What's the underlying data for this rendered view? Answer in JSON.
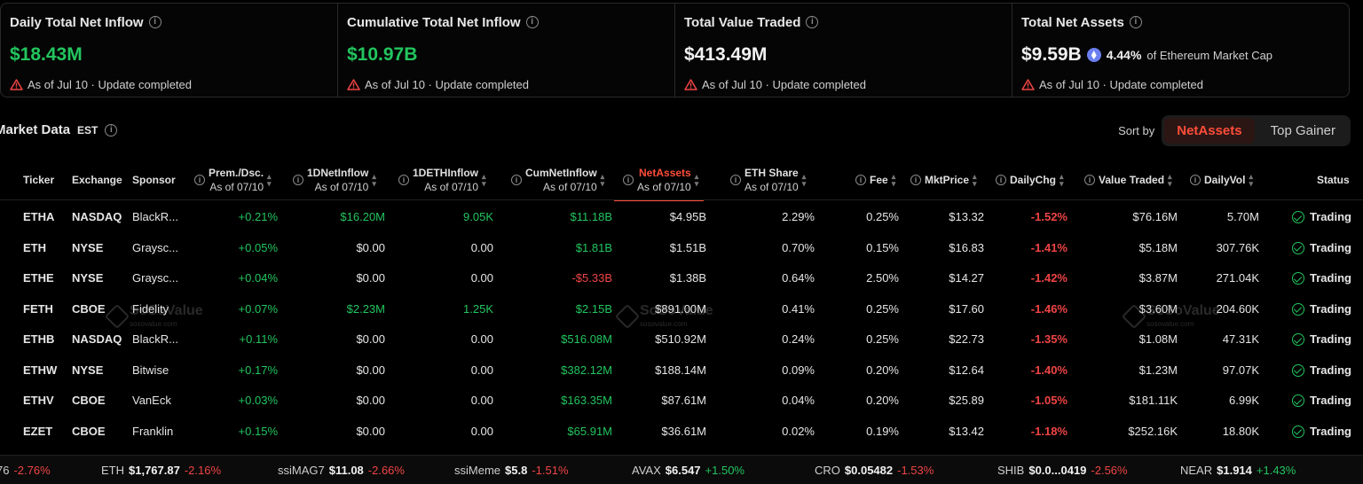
{
  "stats": [
    {
      "title": "Daily Total Net Inflow",
      "value": "$18.43M",
      "foot": "As of Jul 10 · Update completed"
    },
    {
      "title": "Cumulative Total Net Inflow",
      "value": "$10.97B",
      "foot": "As of Jul 10 · Update completed"
    },
    {
      "title": "Total Value Traded",
      "value": "$413.49M",
      "foot": "As of Jul 10 · Update completed"
    },
    {
      "title": "Total Net Assets",
      "value": "$9.59B",
      "mcap_pct": "4.44%",
      "mcap_label": "of Ethereum Market Cap",
      "foot": "As of Jul 10 · Update completed"
    }
  ],
  "market": {
    "title": "Market Data",
    "tz": "EST"
  },
  "sort": {
    "label": "Sort by",
    "options": [
      "NetAssets",
      "Top Gainer"
    ],
    "active": "NetAssets"
  },
  "columns": {
    "ticker": "Ticker",
    "exchange": "Exchange",
    "sponsor": "Sponsor",
    "prem": "Prem./Dsc.",
    "prem_sub": "As of 07/10",
    "netinflow": "1DNetInflow",
    "netinflow_sub": "As of 07/10",
    "ethinflow": "1DETHInflow",
    "ethinflow_sub": "As of 07/10",
    "cumnet": "CumNetInflow",
    "cumnet_sub": "As of 07/10",
    "netassets": "NetAssets",
    "netassets_sub": "As of 07/10",
    "ethshare": "ETH Share",
    "ethshare_sub": "As of 07/10",
    "fee": "Fee",
    "mktprice": "MktPrice",
    "dailychg": "DailyChg",
    "valuetraded": "Value Traded",
    "dailyvol": "DailyVol",
    "status": "Status"
  },
  "rows": [
    {
      "ticker": "ETHA",
      "exchange": "NASDAQ",
      "sponsor": "BlackR...",
      "prem": "+0.21%",
      "netinflow": "$16.20M",
      "ethinflow": "9.05K",
      "cumnet": "$11.18B",
      "netassets": "$4.95B",
      "ethshare": "2.29%",
      "fee": "0.25%",
      "mktprice": "$13.32",
      "dailychg": "-1.52%",
      "valuetraded": "$76.16M",
      "dailyvol": "5.70M",
      "status": "Trading"
    },
    {
      "ticker": "ETH",
      "exchange": "NYSE",
      "sponsor": "Graysc...",
      "prem": "+0.05%",
      "netinflow": "$0.00",
      "ethinflow": "0.00",
      "cumnet": "$1.81B",
      "netassets": "$1.51B",
      "ethshare": "0.70%",
      "fee": "0.15%",
      "mktprice": "$16.83",
      "dailychg": "-1.41%",
      "valuetraded": "$5.18M",
      "dailyvol": "307.76K",
      "status": "Trading"
    },
    {
      "ticker": "ETHE",
      "exchange": "NYSE",
      "sponsor": "Graysc...",
      "prem": "+0.04%",
      "netinflow": "$0.00",
      "ethinflow": "0.00",
      "cumnet": "-$5.33B",
      "netassets": "$1.38B",
      "ethshare": "0.64%",
      "fee": "2.50%",
      "mktprice": "$14.27",
      "dailychg": "-1.42%",
      "valuetraded": "$3.87M",
      "dailyvol": "271.04K",
      "status": "Trading"
    },
    {
      "ticker": "FETH",
      "exchange": "CBOE",
      "sponsor": "Fidelity",
      "prem": "+0.07%",
      "netinflow": "$2.23M",
      "ethinflow": "1.25K",
      "cumnet": "$2.15B",
      "netassets": "$891.00M",
      "ethshare": "0.41%",
      "fee": "0.25%",
      "mktprice": "$17.60",
      "dailychg": "-1.46%",
      "valuetraded": "$3.60M",
      "dailyvol": "204.60K",
      "status": "Trading"
    },
    {
      "ticker": "ETHB",
      "exchange": "NASDAQ",
      "sponsor": "BlackR...",
      "prem": "+0.11%",
      "netinflow": "$0.00",
      "ethinflow": "0.00",
      "cumnet": "$516.08M",
      "netassets": "$510.92M",
      "ethshare": "0.24%",
      "fee": "0.25%",
      "mktprice": "$22.73",
      "dailychg": "-1.35%",
      "valuetraded": "$1.08M",
      "dailyvol": "47.31K",
      "status": "Trading"
    },
    {
      "ticker": "ETHW",
      "exchange": "NYSE",
      "sponsor": "Bitwise",
      "prem": "+0.17%",
      "netinflow": "$0.00",
      "ethinflow": "0.00",
      "cumnet": "$382.12M",
      "netassets": "$188.14M",
      "ethshare": "0.09%",
      "fee": "0.20%",
      "mktprice": "$12.64",
      "dailychg": "-1.40%",
      "valuetraded": "$1.23M",
      "dailyvol": "97.07K",
      "status": "Trading"
    },
    {
      "ticker": "ETHV",
      "exchange": "CBOE",
      "sponsor": "VanEck",
      "prem": "+0.03%",
      "netinflow": "$0.00",
      "ethinflow": "0.00",
      "cumnet": "$163.35M",
      "netassets": "$87.61M",
      "ethshare": "0.04%",
      "fee": "0.20%",
      "mktprice": "$25.89",
      "dailychg": "-1.05%",
      "valuetraded": "$181.11K",
      "dailyvol": "6.99K",
      "status": "Trading"
    },
    {
      "ticker": "EZET",
      "exchange": "CBOE",
      "sponsor": "Franklin",
      "prem": "+0.15%",
      "netinflow": "$0.00",
      "ethinflow": "0.00",
      "cumnet": "$65.91M",
      "netassets": "$36.61M",
      "ethshare": "0.02%",
      "fee": "0.19%",
      "mktprice": "$13.42",
      "dailychg": "-1.18%",
      "valuetraded": "$252.16K",
      "dailyvol": "18.80K",
      "status": "Trading"
    }
  ],
  "watermark": {
    "name": "SoSoValue",
    "domain": "sosovalue.com"
  },
  "ticker_tape": [
    {
      "sym": "",
      "price": "76",
      "chg": "-2.76%"
    },
    {
      "sym": "ETH",
      "price": "$1,767.87",
      "chg": "-2.16%"
    },
    {
      "sym": "ssiMAG7",
      "price": "$11.08",
      "chg": "-2.66%"
    },
    {
      "sym": "ssiMeme",
      "price": "$5.8",
      "chg": "-1.51%"
    },
    {
      "sym": "AVAX",
      "price": "$6.547",
      "chg": "+1.50%"
    },
    {
      "sym": "CRO",
      "price": "$0.05482",
      "chg": "-1.53%"
    },
    {
      "sym": "SHIB",
      "price": "$0.0...0419",
      "chg": "-2.56%"
    },
    {
      "sym": "NEAR",
      "price": "$1.914",
      "chg": "+1.43%"
    }
  ],
  "colors": {
    "positive": "#22c55e",
    "negative": "#ef4444",
    "accent": "#ff4d3a"
  },
  "icons": {
    "info": "info-icon",
    "warning": "warning-icon",
    "status": "check-circle-icon",
    "eth": "ethereum-icon"
  }
}
